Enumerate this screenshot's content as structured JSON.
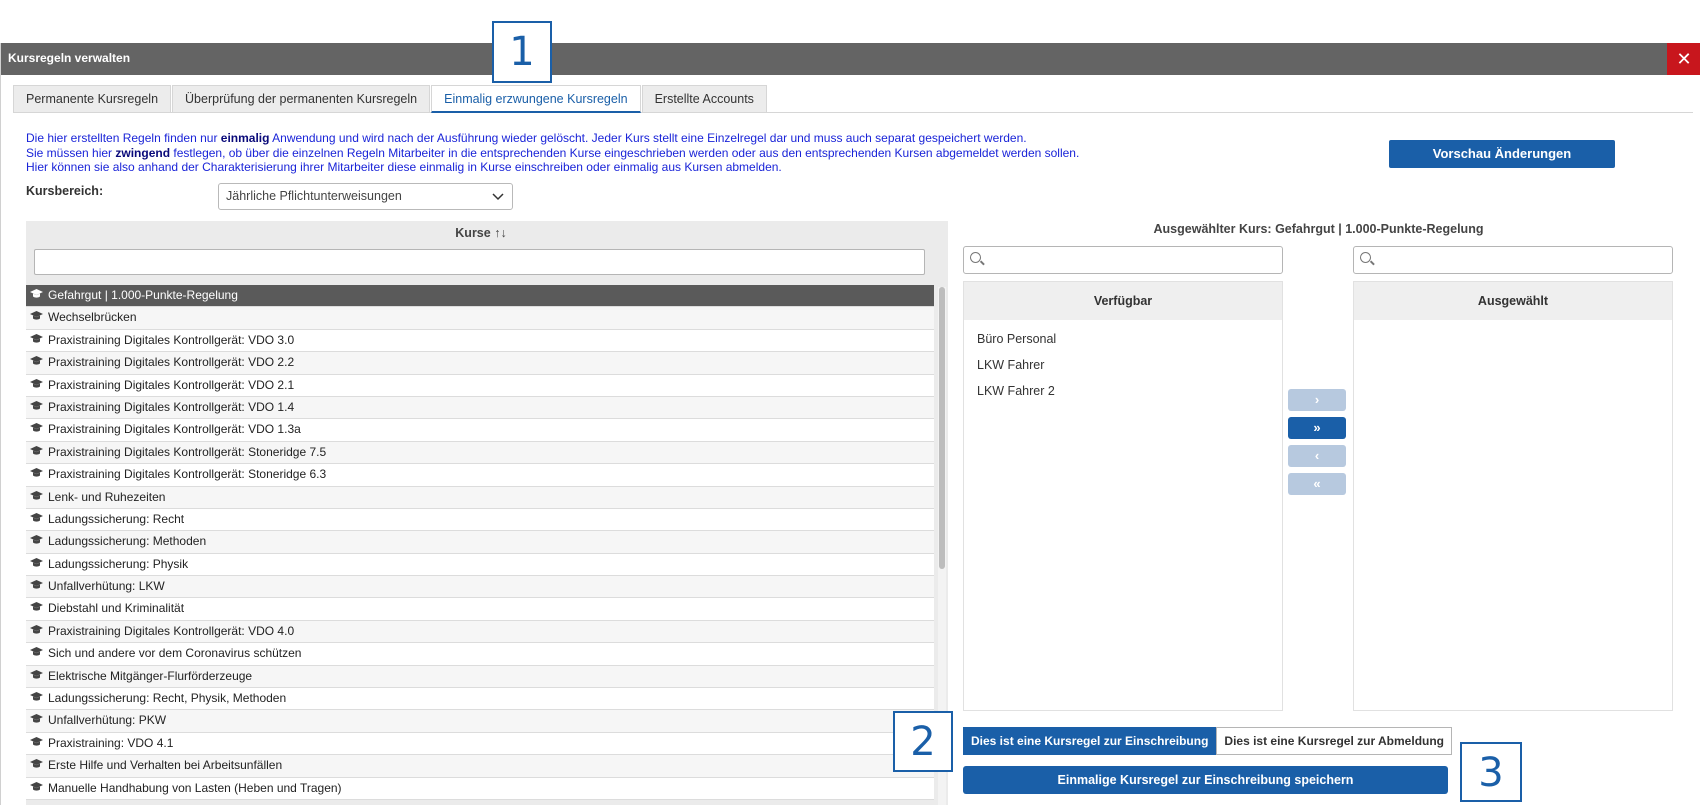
{
  "dialog": {
    "title": "Kursregeln verwalten",
    "close_icon": "✕"
  },
  "tabs": [
    {
      "label": "Permanente Kursregeln"
    },
    {
      "label": "Überprüfung der permanenten Kursregeln"
    },
    {
      "label": "Einmalig erzwungene Kursregeln",
      "active": true
    },
    {
      "label": "Erstellte Accounts"
    }
  ],
  "info": {
    "line1_a": "Die hier erstellten Regeln finden nur ",
    "line1_b": "einmalig",
    "line1_c": " Anwendung und wird nach der Ausführung wieder gelöscht. Jeder Kurs stellt eine Einzelregel dar und muss auch separat gespeichert werden.",
    "line2_a": "Sie müssen hier ",
    "line2_b": "zwingend",
    "line2_c": " festlegen, ob über die einzelnen Regeln Mitarbeiter in die entsprechenden Kurse eingeschrieben werden oder aus den entsprechenden Kursen abgemeldet werden sollen.",
    "line3": "Hier können sie also anhand der Charakterisierung ihrer Mitarbeiter diese einmalig in Kurse einschreiben oder einmalig aus Kursen abmelden."
  },
  "preview_button": "Vorschau Änderungen",
  "kursbereich": {
    "label": "Kursbereich:",
    "value": "Jährliche Pflichtunterweisungen"
  },
  "courses": {
    "header": "Kurse",
    "sort_icon": "↑↓",
    "items": [
      "Gefahrgut | 1.000-Punkte-Regelung",
      "Wechselbrücken",
      "Praxistraining Digitales Kontrollgerät: VDO 3.0",
      "Praxistraining Digitales Kontrollgerät: VDO 2.2",
      "Praxistraining Digitales Kontrollgerät: VDO 2.1",
      "Praxistraining Digitales Kontrollgerät: VDO 1.4",
      "Praxistraining Digitales Kontrollgerät: VDO 1.3a",
      "Praxistraining Digitales Kontrollgerät: Stoneridge 7.5",
      "Praxistraining Digitales Kontrollgerät: Stoneridge 6.3",
      "Lenk- und Ruhezeiten",
      "Ladungssicherung: Recht",
      "Ladungssicherung: Methoden",
      "Ladungssicherung: Physik",
      "Unfallverhütung: LKW",
      "Diebstahl und Kriminalität",
      "Praxistraining Digitales Kontrollgerät: VDO 4.0",
      "Sich und andere vor dem Coronavirus schützen",
      "Elektrische Mitgänger-Flurförderzeuge",
      "Ladungssicherung: Recht, Physik, Methoden",
      "Unfallverhütung: PKW",
      "Praxistraining: VDO 4.1",
      "Erste Hilfe und Verhalten bei Arbeitsunfällen",
      "Manuelle Handhabung von Lasten (Heben und Tragen)"
    ],
    "cap_icon": "🎓"
  },
  "selected_course": "Ausgewählter Kurs: Gefahrgut | 1.000-Punkte-Regelung",
  "available": {
    "header": "Verfügbar",
    "items": [
      "Büro Personal",
      "LKW Fahrer",
      "LKW Fahrer 2"
    ]
  },
  "selected": {
    "header": "Ausgewählt",
    "items": []
  },
  "move_buttons": {
    "right_one": "›",
    "right_all": "»",
    "left_one": "‹",
    "left_all": "«"
  },
  "toggle": {
    "enroll": "Dies ist eine Kursregel zur Einschreibung",
    "unenroll": "Dies ist eine Kursregel zur Abmeldung"
  },
  "save_button": "Einmalige Kursregel zur Einschreibung speichern",
  "markers": {
    "m1": "1",
    "m2": "2",
    "m3": "3"
  },
  "colors": {
    "accent": "#1a5fa8",
    "close": "#c8161d",
    "titlebar": "#646464",
    "info_text": "#1a24d8"
  }
}
